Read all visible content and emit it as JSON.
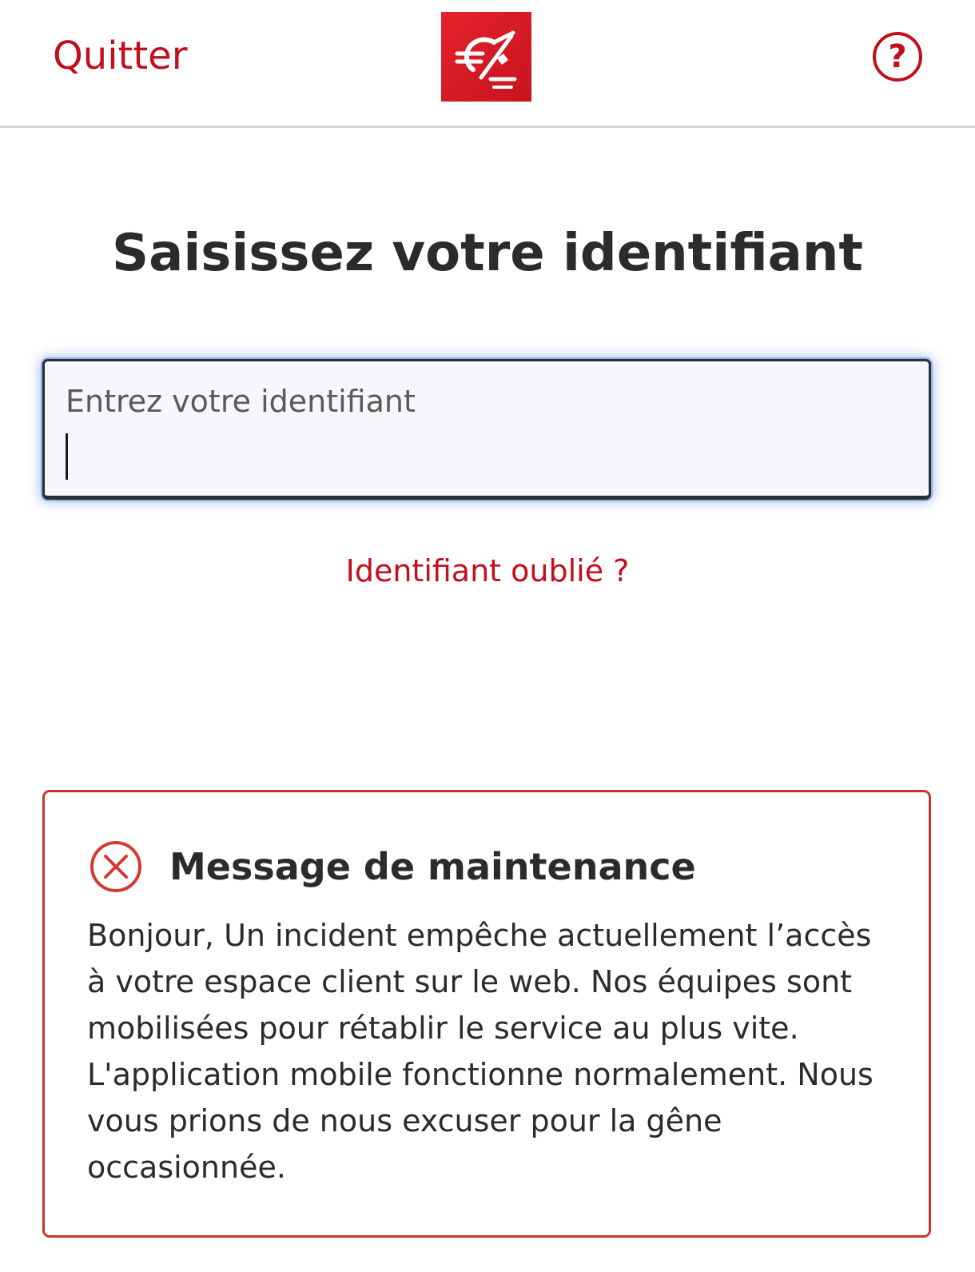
{
  "header": {
    "quit_label": "Quitter",
    "logo_icon": "caisse-epargne-logo-icon",
    "help_icon": "question-mark-icon",
    "help_label": "?"
  },
  "main": {
    "title": "Saisissez votre identifiant",
    "input": {
      "label": "Entrez votre identifiant",
      "value": ""
    },
    "forgot_link": "Identifiant oublié ?"
  },
  "alert": {
    "icon": "error-x-circle-icon",
    "title": "Message de maintenance",
    "body": "Bonjour, Un incident empêche actuellement l’accès à votre espace client sur le web. Nos équipes sont mobilisées pour rétablir le service au plus vite. L'application mobile fonctionne normalement.  Nous vous prions de nous excuser pour la gêne occasionnée."
  },
  "colors": {
    "brand_red": "#c30f1c",
    "alert_border": "#c8362e",
    "focus_ring": "#8eaee8"
  }
}
